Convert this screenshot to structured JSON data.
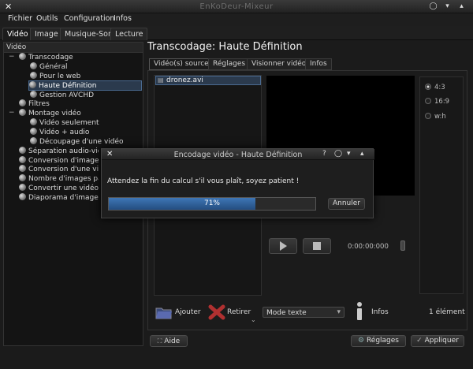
{
  "window": {
    "title": "EnKoDeur-Mixeur"
  },
  "menu": [
    "Fichier",
    "Outils",
    "Configuration",
    "Infos"
  ],
  "tabs": [
    "Vidéo",
    "Image",
    "Musique-Son",
    "Lecture"
  ],
  "sidebar": {
    "header": "Vidéo",
    "items": [
      "Transcodage",
      "Général",
      "Pour le web",
      "Haute Définition",
      "Gestion AVCHD",
      "Filtres",
      "Montage vidéo",
      "Vidéo seulement",
      "Vidéo + audio",
      "Découpage d'une vidéo",
      "Séparation audio-vidéo",
      "Conversion d'images",
      "Conversion d'une vidéo",
      "Nombre d'images par",
      "Convertir une vidéo en",
      "Diaporama d'images"
    ],
    "expanders": [
      "−",
      "−"
    ]
  },
  "main": {
    "title": "Transcodage: Haute Définition",
    "subtabs": [
      "Vidéo(s) source",
      "Réglages",
      "Visionner vidéo",
      "Infos"
    ],
    "file": "dronez.avi",
    "aspect": [
      "4:3",
      "16:9",
      "w:h"
    ],
    "time": "0:00:00:000",
    "add_label": "Ajouter",
    "remove_label": "Retirer",
    "mode_select": "Mode texte",
    "infos_label": "Infos",
    "count": "1 élément"
  },
  "bottom": {
    "help": "Aide",
    "settings": "Réglages",
    "apply": "Appliquer"
  },
  "dialog": {
    "title": "Encodage vidéo - Haute Définition",
    "message": "Attendez la fin du calcul s'il vous plaît, soyez patient !",
    "progress_text": "71%",
    "progress": 0.71,
    "cancel": "Annuler"
  },
  "colors": {
    "accent": "#3f76b5",
    "selection": "#2b3a4d",
    "background": "#1b1b1b"
  }
}
